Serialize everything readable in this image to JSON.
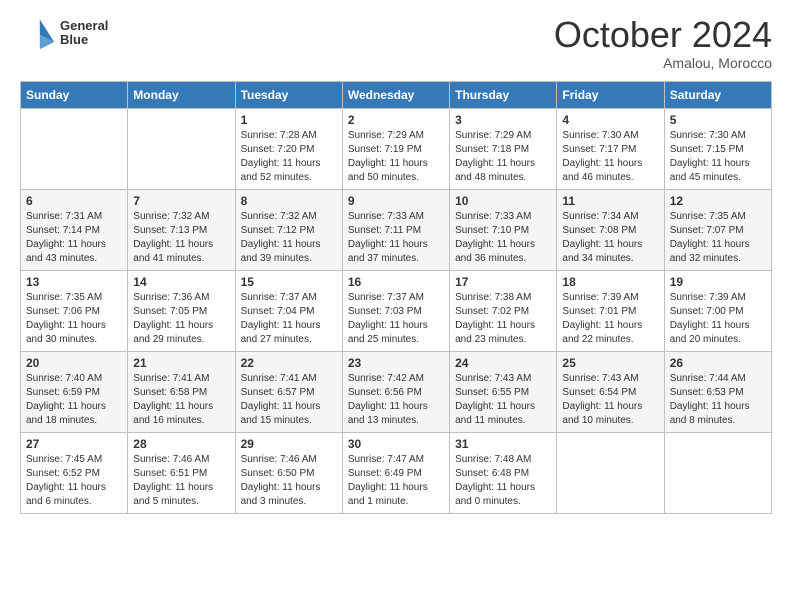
{
  "header": {
    "logo_line1": "General",
    "logo_line2": "Blue",
    "month": "October 2024",
    "location": "Amalou, Morocco"
  },
  "weekdays": [
    "Sunday",
    "Monday",
    "Tuesday",
    "Wednesday",
    "Thursday",
    "Friday",
    "Saturday"
  ],
  "weeks": [
    [
      {
        "day": "",
        "info": ""
      },
      {
        "day": "",
        "info": ""
      },
      {
        "day": "1",
        "info": "Sunrise: 7:28 AM\nSunset: 7:20 PM\nDaylight: 11 hours and 52 minutes."
      },
      {
        "day": "2",
        "info": "Sunrise: 7:29 AM\nSunset: 7:19 PM\nDaylight: 11 hours and 50 minutes."
      },
      {
        "day": "3",
        "info": "Sunrise: 7:29 AM\nSunset: 7:18 PM\nDaylight: 11 hours and 48 minutes."
      },
      {
        "day": "4",
        "info": "Sunrise: 7:30 AM\nSunset: 7:17 PM\nDaylight: 11 hours and 46 minutes."
      },
      {
        "day": "5",
        "info": "Sunrise: 7:30 AM\nSunset: 7:15 PM\nDaylight: 11 hours and 45 minutes."
      }
    ],
    [
      {
        "day": "6",
        "info": "Sunrise: 7:31 AM\nSunset: 7:14 PM\nDaylight: 11 hours and 43 minutes."
      },
      {
        "day": "7",
        "info": "Sunrise: 7:32 AM\nSunset: 7:13 PM\nDaylight: 11 hours and 41 minutes."
      },
      {
        "day": "8",
        "info": "Sunrise: 7:32 AM\nSunset: 7:12 PM\nDaylight: 11 hours and 39 minutes."
      },
      {
        "day": "9",
        "info": "Sunrise: 7:33 AM\nSunset: 7:11 PM\nDaylight: 11 hours and 37 minutes."
      },
      {
        "day": "10",
        "info": "Sunrise: 7:33 AM\nSunset: 7:10 PM\nDaylight: 11 hours and 36 minutes."
      },
      {
        "day": "11",
        "info": "Sunrise: 7:34 AM\nSunset: 7:08 PM\nDaylight: 11 hours and 34 minutes."
      },
      {
        "day": "12",
        "info": "Sunrise: 7:35 AM\nSunset: 7:07 PM\nDaylight: 11 hours and 32 minutes."
      }
    ],
    [
      {
        "day": "13",
        "info": "Sunrise: 7:35 AM\nSunset: 7:06 PM\nDaylight: 11 hours and 30 minutes."
      },
      {
        "day": "14",
        "info": "Sunrise: 7:36 AM\nSunset: 7:05 PM\nDaylight: 11 hours and 29 minutes."
      },
      {
        "day": "15",
        "info": "Sunrise: 7:37 AM\nSunset: 7:04 PM\nDaylight: 11 hours and 27 minutes."
      },
      {
        "day": "16",
        "info": "Sunrise: 7:37 AM\nSunset: 7:03 PM\nDaylight: 11 hours and 25 minutes."
      },
      {
        "day": "17",
        "info": "Sunrise: 7:38 AM\nSunset: 7:02 PM\nDaylight: 11 hours and 23 minutes."
      },
      {
        "day": "18",
        "info": "Sunrise: 7:39 AM\nSunset: 7:01 PM\nDaylight: 11 hours and 22 minutes."
      },
      {
        "day": "19",
        "info": "Sunrise: 7:39 AM\nSunset: 7:00 PM\nDaylight: 11 hours and 20 minutes."
      }
    ],
    [
      {
        "day": "20",
        "info": "Sunrise: 7:40 AM\nSunset: 6:59 PM\nDaylight: 11 hours and 18 minutes."
      },
      {
        "day": "21",
        "info": "Sunrise: 7:41 AM\nSunset: 6:58 PM\nDaylight: 11 hours and 16 minutes."
      },
      {
        "day": "22",
        "info": "Sunrise: 7:41 AM\nSunset: 6:57 PM\nDaylight: 11 hours and 15 minutes."
      },
      {
        "day": "23",
        "info": "Sunrise: 7:42 AM\nSunset: 6:56 PM\nDaylight: 11 hours and 13 minutes."
      },
      {
        "day": "24",
        "info": "Sunrise: 7:43 AM\nSunset: 6:55 PM\nDaylight: 11 hours and 11 minutes."
      },
      {
        "day": "25",
        "info": "Sunrise: 7:43 AM\nSunset: 6:54 PM\nDaylight: 11 hours and 10 minutes."
      },
      {
        "day": "26",
        "info": "Sunrise: 7:44 AM\nSunset: 6:53 PM\nDaylight: 11 hours and 8 minutes."
      }
    ],
    [
      {
        "day": "27",
        "info": "Sunrise: 7:45 AM\nSunset: 6:52 PM\nDaylight: 11 hours and 6 minutes."
      },
      {
        "day": "28",
        "info": "Sunrise: 7:46 AM\nSunset: 6:51 PM\nDaylight: 11 hours and 5 minutes."
      },
      {
        "day": "29",
        "info": "Sunrise: 7:46 AM\nSunset: 6:50 PM\nDaylight: 11 hours and 3 minutes."
      },
      {
        "day": "30",
        "info": "Sunrise: 7:47 AM\nSunset: 6:49 PM\nDaylight: 11 hours and 1 minute."
      },
      {
        "day": "31",
        "info": "Sunrise: 7:48 AM\nSunset: 6:48 PM\nDaylight: 11 hours and 0 minutes."
      },
      {
        "day": "",
        "info": ""
      },
      {
        "day": "",
        "info": ""
      }
    ]
  ]
}
